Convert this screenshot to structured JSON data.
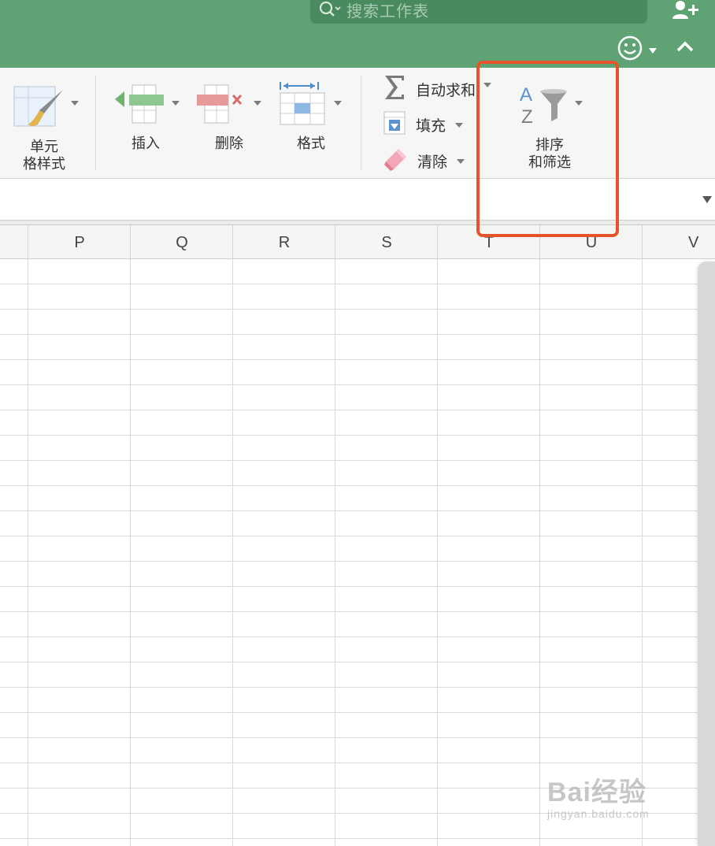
{
  "titlebar": {
    "search_placeholder": "搜索工作表",
    "colors": {
      "bar": "#5fa375",
      "search_bg": "#4a8a5f"
    },
    "icons": [
      "search-icon",
      "chevron-down-icon",
      "add-user-icon",
      "smiley-icon",
      "collapse-ribbon-icon"
    ]
  },
  "ribbon": {
    "cell_styles": {
      "label_line1": "单元",
      "label_line2": "格样式",
      "icon": "paintbrush-icon"
    },
    "insert": {
      "label": "插入",
      "icon": "insert-cells-icon"
    },
    "delete": {
      "label": "删除",
      "icon": "delete-cells-icon"
    },
    "format": {
      "label": "格式",
      "icon": "format-cells-icon"
    },
    "autosum": {
      "label": "自动求和",
      "icon": "sigma-icon"
    },
    "fill": {
      "label": "填充",
      "icon": "fill-down-icon"
    },
    "clear": {
      "label": "清除",
      "icon": "eraser-icon"
    },
    "sort_filter": {
      "label_line1": "排序",
      "label_line2": "和筛选",
      "icon": "sort-filter-icon"
    }
  },
  "grid": {
    "columns": [
      "P",
      "Q",
      "R",
      "S",
      "T",
      "U",
      "V"
    ]
  },
  "annotation": {
    "color": "#e5542a"
  },
  "watermark": {
    "brand": "Bai经验",
    "url": "jingyan.baidu.com"
  }
}
